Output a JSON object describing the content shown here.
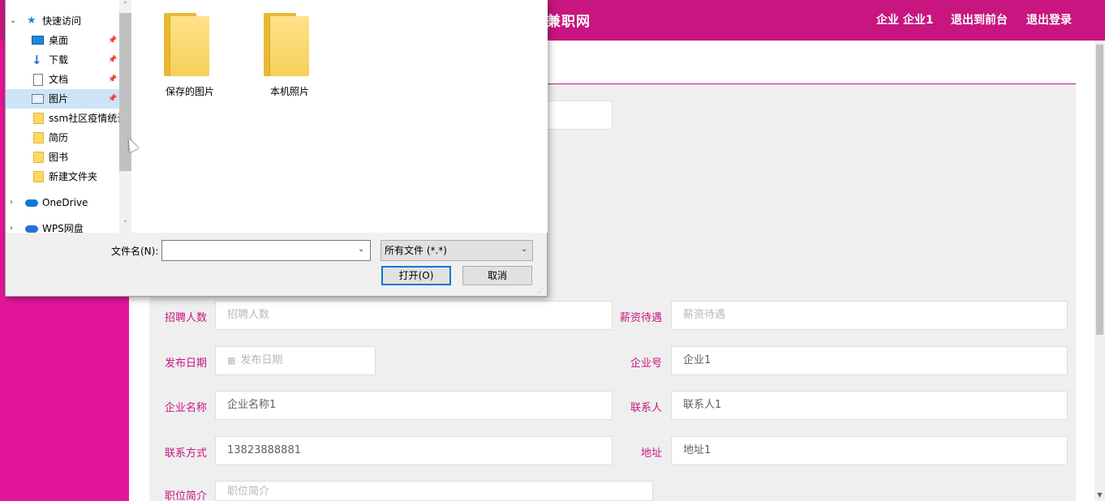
{
  "site": {
    "title": "兼职网",
    "nav": [
      "企业 企业1",
      "退出到前台",
      "退出登录"
    ]
  },
  "form": {
    "fields": [
      {
        "label": "招聘人数",
        "value": "",
        "placeholder": "招聘人数"
      },
      {
        "label": "薪资待遇",
        "value": "",
        "placeholder": "薪资待遇"
      },
      {
        "label": "发布日期",
        "value": "",
        "placeholder": "发布日期"
      },
      {
        "label": "企业号",
        "value": "企业1",
        "placeholder": ""
      },
      {
        "label": "企业名称",
        "value": "企业名称1",
        "placeholder": ""
      },
      {
        "label": "联系人",
        "value": "联系人1",
        "placeholder": ""
      },
      {
        "label": "联系方式",
        "value": "13823888881",
        "placeholder": ""
      },
      {
        "label": "地址",
        "value": "地址1",
        "placeholder": ""
      },
      {
        "label": "职位简介",
        "value": "",
        "placeholder": "职位简介"
      }
    ]
  },
  "dialog": {
    "nav": {
      "quick_access": "快速访问",
      "items": [
        {
          "label": "桌面",
          "icon": "desktop-icon",
          "pinned": true
        },
        {
          "label": "下载",
          "icon": "download-icon",
          "pinned": true
        },
        {
          "label": "文档",
          "icon": "document-icon",
          "pinned": true
        },
        {
          "label": "图片",
          "icon": "pictures-icon",
          "pinned": true,
          "selected": true
        },
        {
          "label": "ssm社区疫情统计",
          "icon": "folder-icon"
        },
        {
          "label": "简历",
          "icon": "folder-icon"
        },
        {
          "label": "图书",
          "icon": "folder-icon"
        },
        {
          "label": "新建文件夹",
          "icon": "folder-icon"
        }
      ],
      "onedrive": "OneDrive",
      "wps": "WPS网盘"
    },
    "files": [
      {
        "name": "保存的图片",
        "icon": "folder-icon"
      },
      {
        "name": "本机照片",
        "icon": "folder-icon"
      }
    ],
    "filename_label": "文件名(N):",
    "filename_value": "",
    "filetype_value": "所有文件 (*.*)",
    "open_label": "打开(O)",
    "cancel_label": "取消"
  },
  "colors": {
    "brand": "#c8157f",
    "sidebar": "#e3169a",
    "selection": "#cce4f7",
    "primary_button_border": "#0078d7"
  }
}
